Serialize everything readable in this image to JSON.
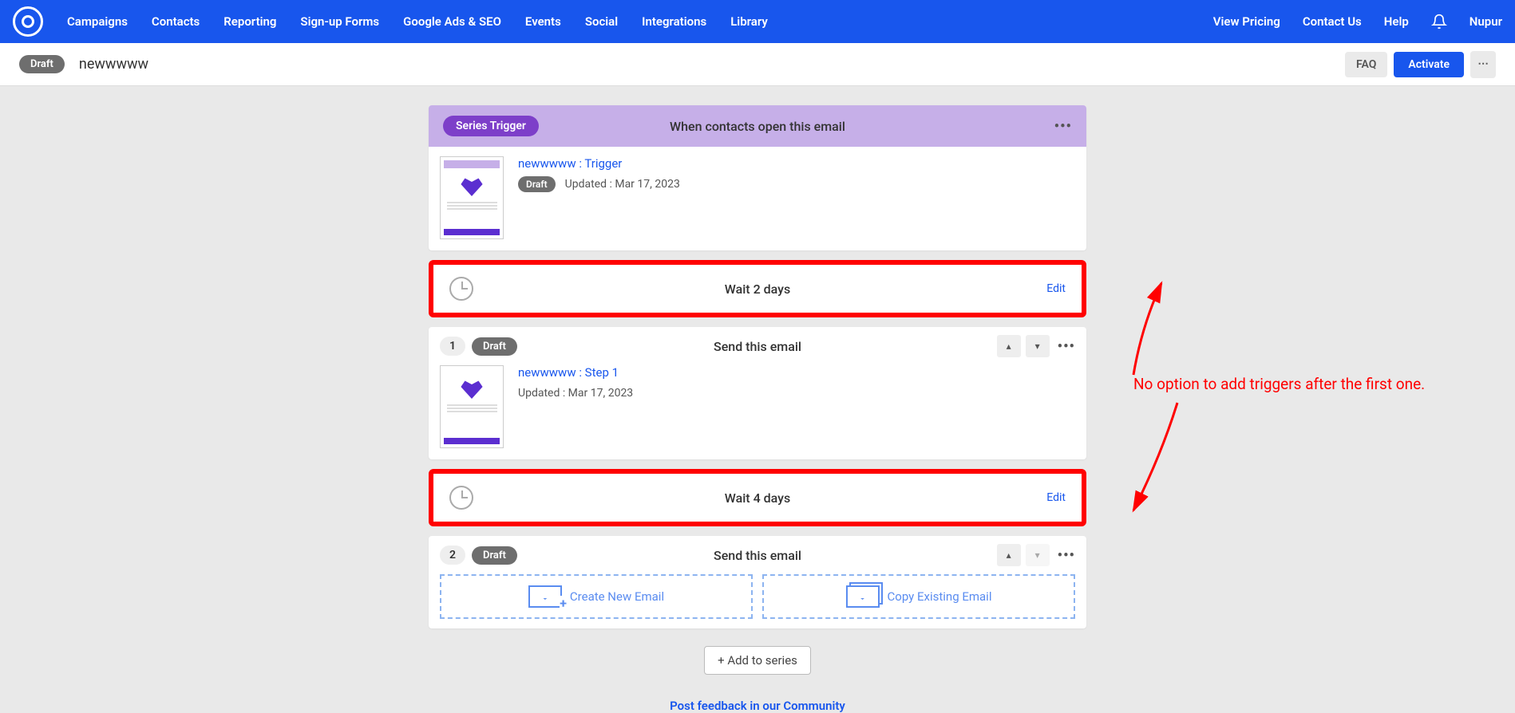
{
  "nav": {
    "items": [
      "Campaigns",
      "Contacts",
      "Reporting",
      "Sign-up Forms",
      "Google Ads & SEO",
      "Events",
      "Social",
      "Integrations",
      "Library"
    ],
    "right": {
      "pricing": "View Pricing",
      "contact": "Contact Us",
      "help": "Help",
      "user": "Nupur"
    }
  },
  "subbar": {
    "status": "Draft",
    "name": "newwwww",
    "faq": "FAQ",
    "activate": "Activate"
  },
  "trigger": {
    "pill": "Series Trigger",
    "title": "When contacts open this email",
    "link": "newwwww : Trigger",
    "status": "Draft",
    "updated": "Updated : Mar 17, 2023"
  },
  "wait1": {
    "text": "Wait 2 days",
    "edit": "Edit"
  },
  "step1": {
    "num": "1",
    "status": "Draft",
    "title": "Send this email",
    "link": "newwwww : Step 1",
    "updated": "Updated : Mar 17, 2023"
  },
  "wait2": {
    "text": "Wait 4 days",
    "edit": "Edit"
  },
  "step2": {
    "num": "2",
    "status": "Draft",
    "title": "Send this email",
    "create": "Create New Email",
    "copy": "Copy Existing Email"
  },
  "addSeries": "Add to series",
  "annotation": "No option to add triggers after the first one.",
  "footer": "Post feedback in our Community"
}
